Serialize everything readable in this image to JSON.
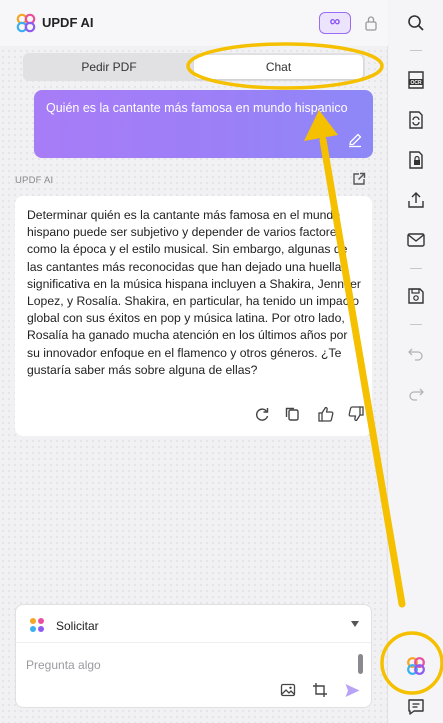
{
  "app": {
    "title": "UPDF AI",
    "mode_icon": "infinity-icon"
  },
  "tabs": [
    {
      "label": "Pedir PDF",
      "active": false
    },
    {
      "label": "Chat",
      "active": true
    }
  ],
  "chat": {
    "user_message": "Quién es la cantante más famosa en mundo hispanico",
    "ai_label": "UPDF AI",
    "ai_response": "Determinar quién es la cantante más famosa en el mundo hispano puede ser subjetivo y depender de varios factores como la época y el estilo musical. Sin embargo, algunas de las cantantes más reconocidas que han dejado una huella significativa en la música hispana incluyen a Shakira, Jennifer Lopez, y Rosalía. Shakira, en particular, ha tenido un impacto global con sus éxitos en pop y música latina. Por otro lado, Rosalía ha ganado mucha atención en los últimos años por su innovador enfoque en el flamenco y otros géneros. ¿Te gustaría saber más sobre alguna de ellas?",
    "actions": [
      "regenerate-icon",
      "copy-icon",
      "thumbs-up-icon",
      "thumbs-down-icon"
    ]
  },
  "composer": {
    "mode_label": "Solicitar",
    "placeholder": "Pregunta algo"
  },
  "toolbar": [
    "search-icon",
    "ocr-icon",
    "convert-icon",
    "protect-icon",
    "share-icon",
    "email-icon",
    "save-icon",
    "undo-icon",
    "redo-icon",
    "updf-ai-icon",
    "comment-icon"
  ],
  "colors": {
    "accent": "#9a6cf3",
    "annotation": "#f5c000"
  }
}
